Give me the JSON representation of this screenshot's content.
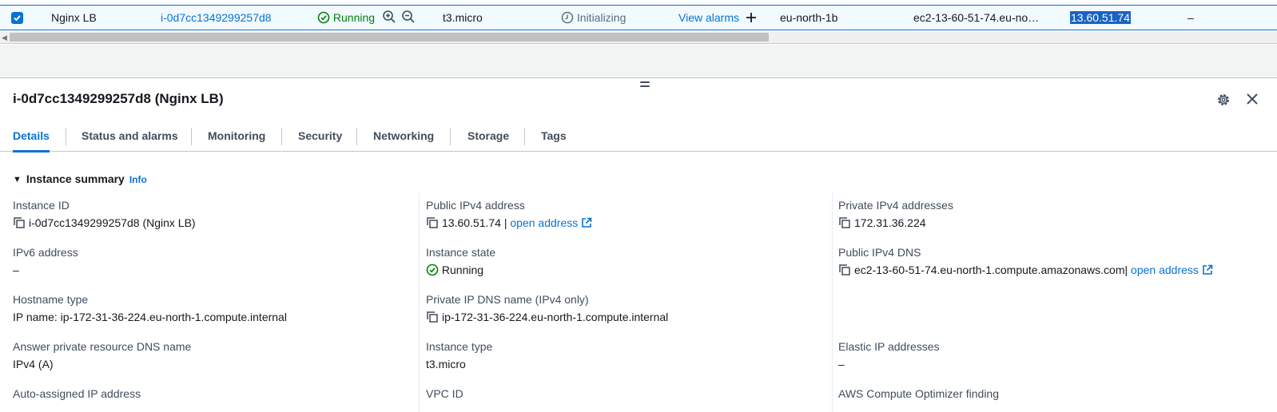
{
  "instance_row": {
    "name": "Nginx LB",
    "instance_id": "i-0d7cc1349299257d8",
    "state": "Running",
    "type": "t3.micro",
    "status_check": "Initializing",
    "alarm_link": "View alarms",
    "az": "eu-north-1b",
    "public_dns": "ec2-13-60-51-74.eu-no…",
    "public_ip": "13.60.51.74",
    "elastic_ip": "–"
  },
  "panel": {
    "title": "i-0d7cc1349299257d8 (Nginx LB)"
  },
  "tabs": [
    {
      "label": "Details"
    },
    {
      "label": "Status and alarms"
    },
    {
      "label": "Monitoring"
    },
    {
      "label": "Security"
    },
    {
      "label": "Networking"
    },
    {
      "label": "Storage"
    },
    {
      "label": "Tags"
    }
  ],
  "summary": {
    "heading": "Instance summary",
    "info": "Info"
  },
  "fields": {
    "instance_id": {
      "label": "Instance ID",
      "value": "i-0d7cc1349299257d8 (Nginx LB)"
    },
    "ipv6": {
      "label": "IPv6 address",
      "value": "–"
    },
    "hostname_type": {
      "label": "Hostname type",
      "value": "IP name: ip-172-31-36-224.eu-north-1.compute.internal"
    },
    "answer_dns": {
      "label": "Answer private resource DNS name",
      "value": "IPv4 (A)"
    },
    "auto_ip": {
      "label": "Auto-assigned IP address"
    },
    "public_ipv4": {
      "label": "Public IPv4 address",
      "value": "13.60.51.74",
      "separator": "|",
      "link": "open address"
    },
    "instance_state": {
      "label": "Instance state",
      "value": "Running"
    },
    "private_dns": {
      "label": "Private IP DNS name (IPv4 only)",
      "value": "ip-172-31-36-224.eu-north-1.compute.internal"
    },
    "instance_type": {
      "label": "Instance type",
      "value": "t3.micro"
    },
    "vpc_id": {
      "label": "VPC ID"
    },
    "private_ipv4": {
      "label": "Private IPv4 addresses",
      "value": "172.31.36.224"
    },
    "public_dns": {
      "label": "Public IPv4 DNS",
      "value": "ec2-13-60-51-74.eu-north-1.compute.amazonaws.com",
      "separator": "|",
      "link": "open address"
    },
    "elastic_ip": {
      "label": "Elastic IP addresses",
      "value": "–"
    },
    "optimizer": {
      "label": "AWS Compute Optimizer finding"
    }
  },
  "colors": {
    "link": "#0972d3",
    "success": "#037f0c",
    "selected_row_bg": "#f1faff",
    "text": "#16191f"
  },
  "icons": [
    "checkbox-checked-icon",
    "status-success-icon",
    "zoom-in-icon",
    "zoom-out-icon",
    "clock-icon",
    "add-icon",
    "settings-icon",
    "close-icon",
    "copy-icon",
    "external-link-icon",
    "caret-down-icon"
  ]
}
